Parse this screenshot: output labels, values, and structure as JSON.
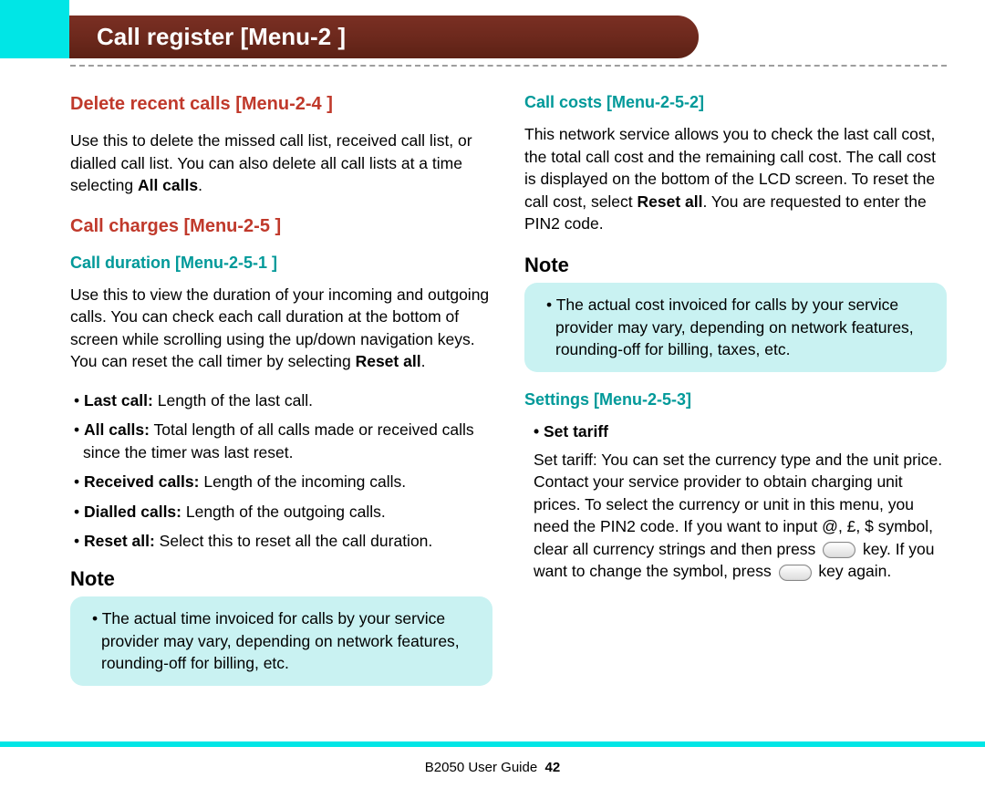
{
  "header": {
    "title": "Call register [Menu-2 ]"
  },
  "left": {
    "deleteRecent": {
      "heading": "Delete recent calls [Menu-2-4 ]",
      "para_a": "Use this to delete the missed call list, received call list, or dialled call list. You can also delete all call lists at a time selecting ",
      "para_bold": "All calls",
      "para_b": "."
    },
    "callCharges": {
      "heading": "Call charges [Menu-2-5 ]"
    },
    "callDuration": {
      "heading": "Call duration [Menu-2-5-1 ]",
      "para_a": "Use this to view the duration of your incoming and outgoing calls. You can check each call duration at the bottom of screen while scrolling using the up/down navigation keys. You can reset the call timer by selecting ",
      "para_bold": "Reset all",
      "para_b": ".",
      "bullets": [
        {
          "label": "Last call:",
          "text": " Length of the last call."
        },
        {
          "label": "All calls:",
          "text": " Total length of all calls made or received calls since the timer was last reset."
        },
        {
          "label": "Received calls:",
          "text": " Length of the incoming calls."
        },
        {
          "label": "Dialled calls:",
          "text": " Length of the outgoing calls."
        },
        {
          "label": "Reset all:",
          "text": " Select this to reset all the call duration."
        }
      ]
    },
    "note": {
      "title": "Note",
      "text": "The actual time invoiced for calls by your service provider may vary, depending on network features, rounding-off for billing, etc."
    }
  },
  "right": {
    "callCosts": {
      "heading": "Call costs [Menu-2-5-2]",
      "para_a": "This network service allows you to check the last call cost, the total call cost and the remaining call cost. The call cost is displayed on the bottom of the LCD screen. To reset the call cost, select ",
      "para_bold": "Reset all",
      "para_b": ". You are requested to enter the PIN2 code."
    },
    "note": {
      "title": "Note",
      "text": "The actual cost invoiced for calls by your service provider may vary, depending on network features, rounding-off for billing, taxes, etc."
    },
    "settings": {
      "heading": "Settings [Menu-2-5-3]",
      "subLabel": "Set tariff",
      "para_a": "Set tariff: You can set the currency type and the unit price. Contact your service provider to obtain charging unit prices. To select the currency or unit in this menu, you need the PIN2 code. If you want to input @, £, $ symbol, clear all currency strings and then press ",
      "para_b": " key. If you want to change the symbol, press ",
      "para_c": " key again."
    }
  },
  "footer": {
    "guide": "B2050 User Guide",
    "page": "42"
  }
}
